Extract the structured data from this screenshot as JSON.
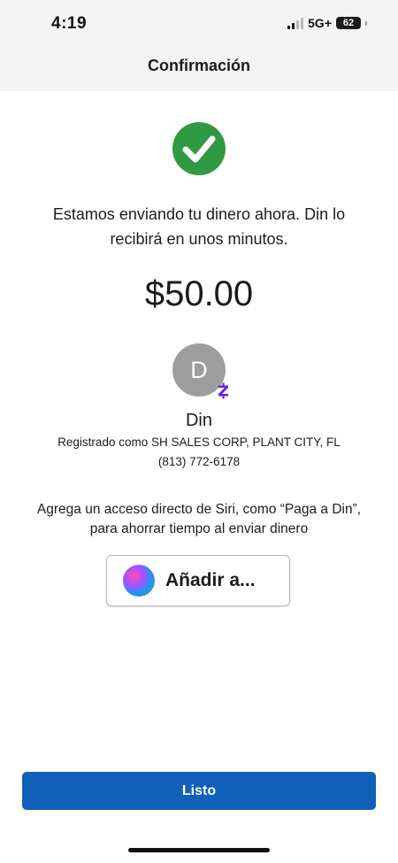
{
  "status_bar": {
    "time": "4:19",
    "network": "5G+",
    "battery": "62"
  },
  "header": {
    "title": "Confirmación"
  },
  "confirmation": {
    "message": "Estamos enviando tu dinero ahora. Din lo recibirá en unos minutos.",
    "amount": "$50.00"
  },
  "recipient": {
    "avatar_initial": "D",
    "name": "Din",
    "registered": "Registrado como SH SALES CORP, PLANT CITY, FL",
    "phone": "(813) 772-6178"
  },
  "siri": {
    "text": "Agrega un acceso directo de Siri, como “Paga a Din”, para ahorrar tiempo al enviar dinero",
    "button_label": "Añadir a..."
  },
  "footer": {
    "done_label": "Listo"
  },
  "icons": {
    "success": "check-circle-icon",
    "payment_service": "zelle-icon",
    "siri": "siri-icon"
  },
  "colors": {
    "success_green": "#2f9a41",
    "primary_blue": "#1160b9",
    "zelle_purple": "#6d1ed4",
    "avatar_gray": "#9d9d9d",
    "header_bg": "#f4f4f5"
  }
}
